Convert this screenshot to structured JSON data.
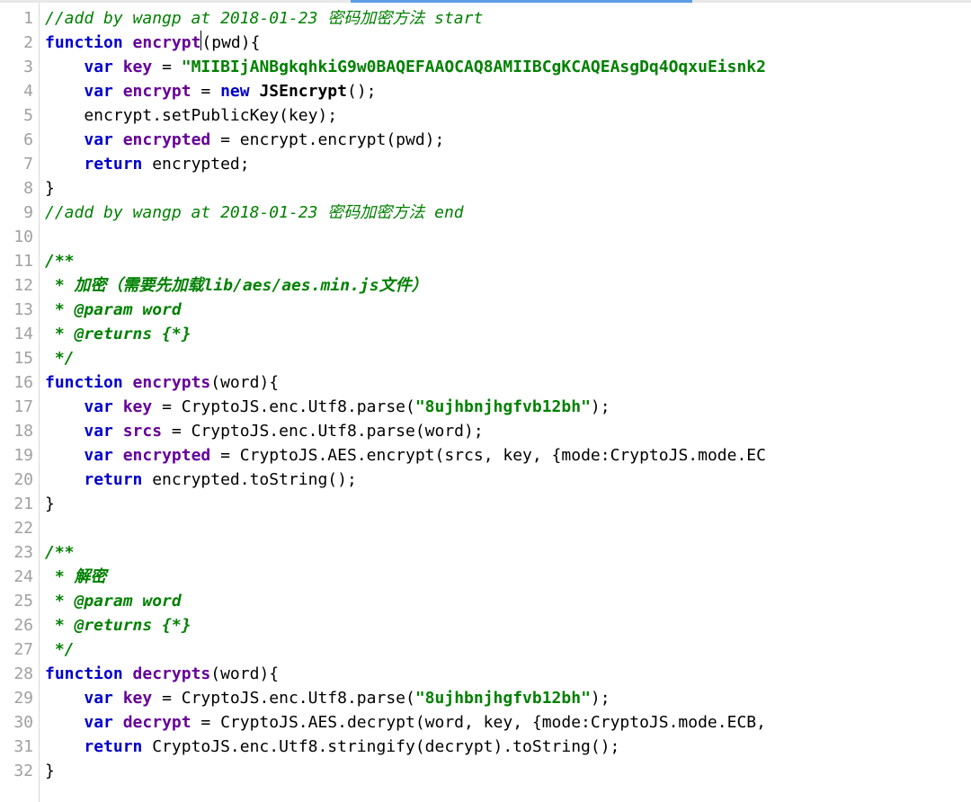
{
  "gutter": {
    "start": 1,
    "end": 32
  },
  "code": {
    "lines": [
      [
        {
          "cls": "tok-comment",
          "t": "//add by wangp at 2018-01-23 密码加密方法 start"
        }
      ],
      [
        {
          "cls": "tok-kw",
          "t": "function "
        },
        {
          "cls": "tok-fn",
          "t": "encrypt"
        },
        {
          "cls": "cursor",
          "t": ""
        },
        {
          "cls": "tok-text",
          "t": "("
        },
        {
          "cls": "tok-param",
          "t": "pwd"
        },
        {
          "cls": "tok-text",
          "t": "){"
        }
      ],
      [
        {
          "cls": "tok-text",
          "t": "    "
        },
        {
          "cls": "tok-kw",
          "t": "var "
        },
        {
          "cls": "tok-varname",
          "t": "key"
        },
        {
          "cls": "tok-text",
          "t": " = "
        },
        {
          "cls": "tok-str",
          "t": "\"MIIBIjANBgkqhkiG9w0BAQEFAAOCAQ8AMIIBCgKCAQEAsgDq4OqxuEisnk2"
        }
      ],
      [
        {
          "cls": "tok-text",
          "t": "    "
        },
        {
          "cls": "tok-kw",
          "t": "var "
        },
        {
          "cls": "tok-varname",
          "t": "encrypt"
        },
        {
          "cls": "tok-text",
          "t": " = "
        },
        {
          "cls": "tok-kw",
          "t": "new "
        },
        {
          "cls": "tok-class",
          "t": "JSEncrypt"
        },
        {
          "cls": "tok-text",
          "t": "();"
        }
      ],
      [
        {
          "cls": "tok-text",
          "t": "    encrypt.setPublicKey(key);"
        }
      ],
      [
        {
          "cls": "tok-text",
          "t": "    "
        },
        {
          "cls": "tok-kw",
          "t": "var "
        },
        {
          "cls": "tok-varname",
          "t": "encrypted"
        },
        {
          "cls": "tok-text",
          "t": " = encrypt.encrypt(pwd);"
        }
      ],
      [
        {
          "cls": "tok-text",
          "t": "    "
        },
        {
          "cls": "tok-kw",
          "t": "return "
        },
        {
          "cls": "tok-text",
          "t": "encrypted;"
        }
      ],
      [
        {
          "cls": "tok-text",
          "t": "}"
        }
      ],
      [
        {
          "cls": "tok-comment",
          "t": "//add by wangp at 2018-01-23 密码加密方法 end"
        }
      ],
      [
        {
          "cls": "tok-text",
          "t": ""
        }
      ],
      [
        {
          "cls": "tok-doc",
          "t": "/**"
        }
      ],
      [
        {
          "cls": "tok-doc",
          "t": " * 加密（需要先加载lib/aes/aes.min.js文件）"
        }
      ],
      [
        {
          "cls": "tok-doc",
          "t": " * @param word"
        }
      ],
      [
        {
          "cls": "tok-doc",
          "t": " * @returns {*}"
        }
      ],
      [
        {
          "cls": "tok-doc",
          "t": " */"
        }
      ],
      [
        {
          "cls": "tok-kw",
          "t": "function "
        },
        {
          "cls": "tok-fn",
          "t": "encrypts"
        },
        {
          "cls": "tok-text",
          "t": "("
        },
        {
          "cls": "tok-param",
          "t": "word"
        },
        {
          "cls": "tok-text",
          "t": "){"
        }
      ],
      [
        {
          "cls": "tok-text",
          "t": "    "
        },
        {
          "cls": "tok-kw",
          "t": "var "
        },
        {
          "cls": "tok-varname",
          "t": "key"
        },
        {
          "cls": "tok-text",
          "t": " = CryptoJS.enc.Utf8.parse("
        },
        {
          "cls": "tok-str",
          "t": "\"8ujhbnjhgfvb12bh\""
        },
        {
          "cls": "tok-text",
          "t": ");"
        }
      ],
      [
        {
          "cls": "tok-text",
          "t": "    "
        },
        {
          "cls": "tok-kw",
          "t": "var "
        },
        {
          "cls": "tok-varname",
          "t": "srcs"
        },
        {
          "cls": "tok-text",
          "t": " = CryptoJS.enc.Utf8.parse(word);"
        }
      ],
      [
        {
          "cls": "tok-text",
          "t": "    "
        },
        {
          "cls": "tok-kw",
          "t": "var "
        },
        {
          "cls": "tok-varname",
          "t": "encrypted"
        },
        {
          "cls": "tok-text",
          "t": " = CryptoJS.AES.encrypt(srcs, key, {mode:CryptoJS.mode.EC"
        }
      ],
      [
        {
          "cls": "tok-text",
          "t": "    "
        },
        {
          "cls": "tok-kw",
          "t": "return "
        },
        {
          "cls": "tok-text",
          "t": "encrypted.toString();"
        }
      ],
      [
        {
          "cls": "tok-text",
          "t": "}"
        }
      ],
      [
        {
          "cls": "tok-text",
          "t": ""
        }
      ],
      [
        {
          "cls": "tok-doc",
          "t": "/**"
        }
      ],
      [
        {
          "cls": "tok-doc",
          "t": " * 解密"
        }
      ],
      [
        {
          "cls": "tok-doc",
          "t": " * @param word"
        }
      ],
      [
        {
          "cls": "tok-doc",
          "t": " * @returns {*}"
        }
      ],
      [
        {
          "cls": "tok-doc",
          "t": " */"
        }
      ],
      [
        {
          "cls": "tok-kw",
          "t": "function "
        },
        {
          "cls": "tok-fn",
          "t": "decrypts"
        },
        {
          "cls": "tok-text",
          "t": "("
        },
        {
          "cls": "tok-param",
          "t": "word"
        },
        {
          "cls": "tok-text",
          "t": "){"
        }
      ],
      [
        {
          "cls": "tok-text",
          "t": "    "
        },
        {
          "cls": "tok-kw",
          "t": "var "
        },
        {
          "cls": "tok-varname",
          "t": "key"
        },
        {
          "cls": "tok-text",
          "t": " = CryptoJS.enc.Utf8.parse("
        },
        {
          "cls": "tok-str",
          "t": "\"8ujhbnjhgfvb12bh\""
        },
        {
          "cls": "tok-text",
          "t": ");"
        }
      ],
      [
        {
          "cls": "tok-text",
          "t": "    "
        },
        {
          "cls": "tok-kw",
          "t": "var "
        },
        {
          "cls": "tok-varname",
          "t": "decrypt"
        },
        {
          "cls": "tok-text",
          "t": " = CryptoJS.AES.decrypt(word, key, {mode:CryptoJS.mode.ECB,"
        }
      ],
      [
        {
          "cls": "tok-text",
          "t": "    "
        },
        {
          "cls": "tok-kw",
          "t": "return "
        },
        {
          "cls": "tok-text",
          "t": "CryptoJS.enc.Utf8.stringify(decrypt).toString();"
        }
      ],
      [
        {
          "cls": "tok-text",
          "t": "}"
        }
      ]
    ]
  }
}
